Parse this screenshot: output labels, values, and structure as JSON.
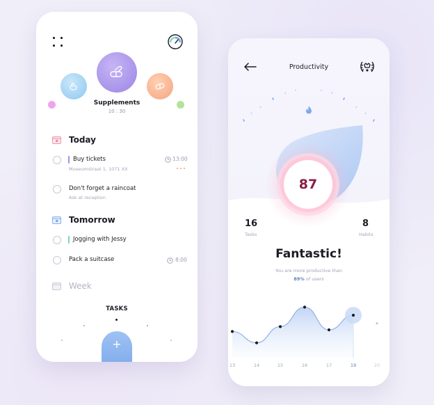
{
  "left": {
    "supplement": {
      "title": "Supplements",
      "time": "10 : 30"
    },
    "sections": {
      "today": "Today",
      "tomorrow": "Tomorrow",
      "week": "Week"
    },
    "today_tasks": [
      {
        "title": "Buy tickets",
        "subtitle": "Museumstraat 1, 1071 XX",
        "time": "13:00",
        "bar_color": "#a98ce8"
      },
      {
        "title": "Don't forget a raincoat",
        "subtitle": "Ask at reception"
      }
    ],
    "tomorrow_tasks": [
      {
        "title": "Jogging with Jessy",
        "bar_color": "#7fd3b8"
      },
      {
        "title": "Pack a suitcase",
        "time": "8:00"
      }
    ],
    "tasks_label": "TASKS",
    "fab_label": "+"
  },
  "right": {
    "title": "Productivity",
    "score": "87",
    "tasks_count": "16",
    "tasks_label": "Tasks",
    "habits_count": "8",
    "habits_label": "Habits",
    "headline": "Fantastic!",
    "sub_line1": "You are more productive than",
    "sub_line2_strong": "89%",
    "sub_line2_rest": " of users",
    "chart_data": {
      "type": "line",
      "categories": [
        "13",
        "14",
        "15",
        "16",
        "17",
        "19",
        "20"
      ],
      "values": [
        42,
        28,
        48,
        72,
        44,
        62,
        null
      ],
      "highlight_index": 5,
      "ylim": [
        20,
        80
      ],
      "grid": false
    }
  },
  "colors": {
    "accent_blue": "#7ea9ec",
    "accent_purple": "#9a86e6",
    "score_text": "#8a1c46",
    "pink_glow": "#f5a8c4"
  }
}
